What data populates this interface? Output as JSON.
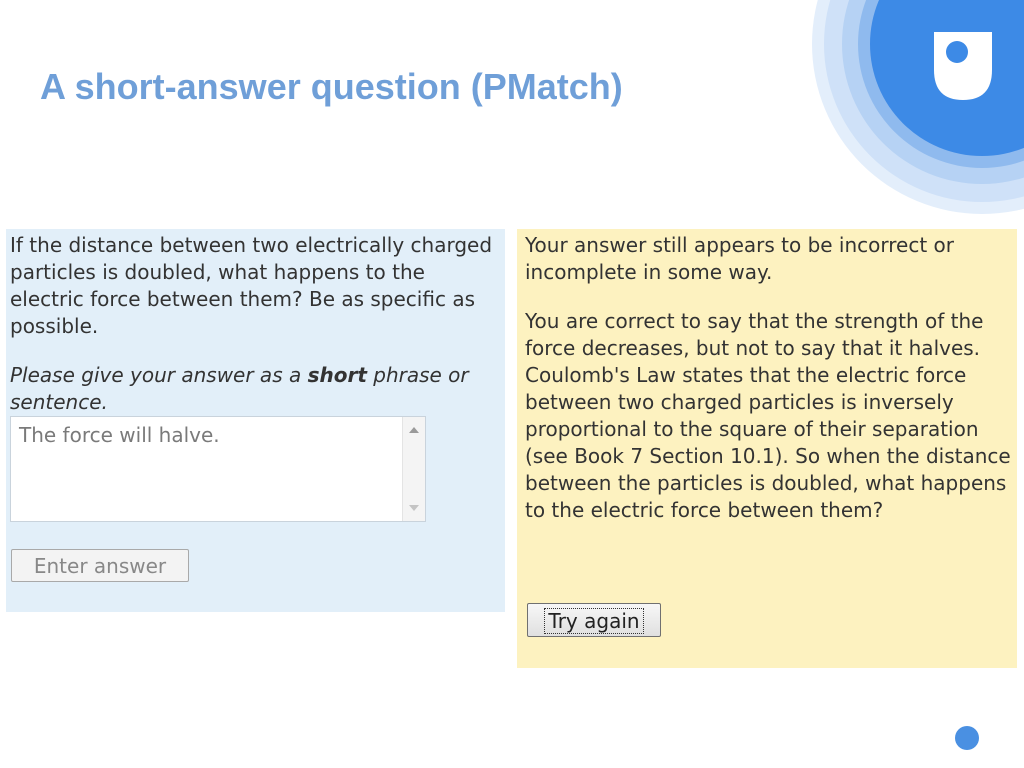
{
  "slide": {
    "title": "A short-answer question (PMatch)"
  },
  "question": {
    "text": "If the distance between two electrically charged particles is doubled, what happens to the electric force between them? Be as specific as possible.",
    "instruction_before": "Please give your answer as a ",
    "instruction_bold": "short",
    "instruction_after": " phrase or sentence.",
    "answer_value": "The force will halve.",
    "submit_label": "Enter answer"
  },
  "feedback": {
    "status": "Your answer still appears to be incorrect or incomplete in some way.",
    "explanation": "You are correct to say that the strength of the force decreases, but not to say that it halves. Coulomb's Law states that the electric force between two charged particles is inversely proportional to the square of their separation (see Book 7 Section 10.1). So when the distance between the particles is doubled, what happens to the electric force between them?",
    "retry_label": "Try again"
  },
  "colors": {
    "title": "#6f9fd8",
    "question_panel": "#e2eff9",
    "feedback_panel": "#fdf2c0",
    "accent_blue": "#4a90e2"
  },
  "icons": {
    "logo": "open-university-logo-icon",
    "dot": "blue-dot-icon"
  }
}
